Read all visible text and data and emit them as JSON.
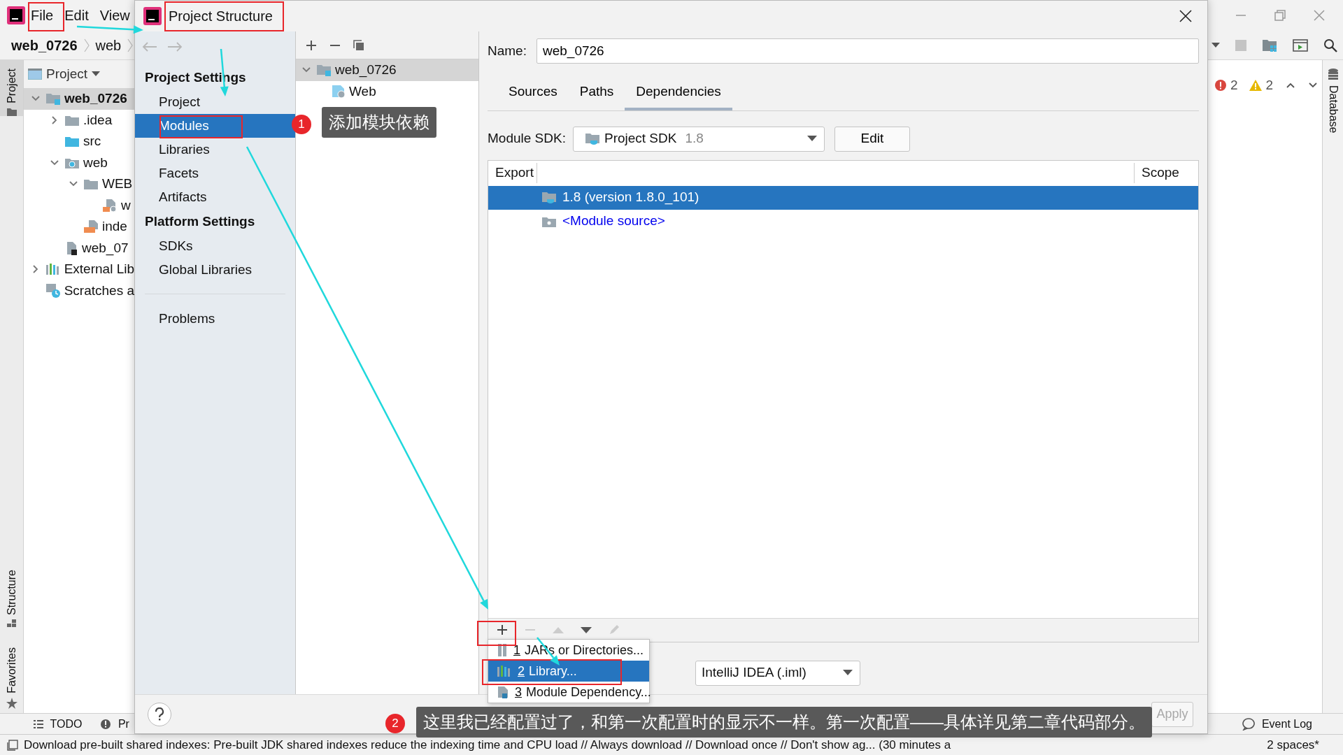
{
  "ide": {
    "menu": [
      "File",
      "Edit",
      "View"
    ],
    "breadcrumbs": [
      "web_0726",
      "web"
    ],
    "tool_strip": [
      "Project",
      "Structure",
      "Favorites"
    ],
    "project_panel": {
      "title": "Project",
      "tree": [
        {
          "label": "web_0726",
          "bold": true,
          "kind": "module",
          "expanded": true,
          "children": [
            {
              "label": ".idea",
              "kind": "folder",
              "expanded": false
            },
            {
              "label": "src",
              "kind": "source"
            },
            {
              "label": "web",
              "kind": "web",
              "expanded": true,
              "children": [
                {
                  "label": "WEB",
                  "kind": "folder",
                  "expanded": true,
                  "children": [
                    {
                      "label": "w",
                      "kind": "xml"
                    }
                  ]
                },
                {
                  "label": "inde",
                  "kind": "jsp"
                }
              ]
            },
            {
              "label": "web_07",
              "kind": "iml"
            }
          ]
        },
        {
          "label": "External Lib",
          "kind": "libs",
          "expanded": false
        },
        {
          "label": "Scratches a",
          "kind": "scratch"
        }
      ]
    },
    "inspections": {
      "errors": "2",
      "warnings": "2"
    },
    "right_strip": "Database",
    "bottom_tabs": [
      "TODO",
      "Pr"
    ],
    "event_log": "Event Log",
    "status": "Download pre-built shared indexes: Pre-built JDK shared indexes reduce the indexing time and CPU load // Always download // Download once // Don't show ag... (30 minutes a",
    "indent": "2 spaces*"
  },
  "dialog": {
    "title": "Project Structure",
    "nav": [
      {
        "kind": "header",
        "label": "Project Settings"
      },
      {
        "kind": "item",
        "label": "Project",
        "selected": false
      },
      {
        "kind": "item",
        "label": "Modules",
        "selected": true
      },
      {
        "kind": "item",
        "label": "Libraries",
        "selected": false
      },
      {
        "kind": "item",
        "label": "Facets",
        "selected": false
      },
      {
        "kind": "item",
        "label": "Artifacts",
        "selected": false
      },
      {
        "kind": "header",
        "label": "Platform Settings"
      },
      {
        "kind": "item",
        "label": "SDKs",
        "selected": false
      },
      {
        "kind": "item",
        "label": "Global Libraries",
        "selected": false
      },
      {
        "kind": "separator"
      },
      {
        "kind": "item",
        "label": "Problems",
        "selected": false
      }
    ],
    "modules": [
      {
        "label": "web_0726",
        "selected": true,
        "expanded": true,
        "children": [
          {
            "label": "Web",
            "selected": false
          }
        ]
      }
    ],
    "name_label": "Name:",
    "name_value": "web_0726",
    "tabs": [
      {
        "label": "Sources",
        "selected": false
      },
      {
        "label": "Paths",
        "selected": false
      },
      {
        "label": "Dependencies",
        "selected": true
      }
    ],
    "sdk_label": "Module SDK:",
    "sdk_value": "Project SDK",
    "sdk_version": "1.8",
    "edit_button": "Edit",
    "table": {
      "columns": [
        "Export",
        "Scope"
      ],
      "rows": [
        {
          "kind": "sdk",
          "text": "1.8 (version 1.8.0_101)",
          "selected": true
        },
        {
          "kind": "source",
          "text": "<Module source>",
          "selected": false
        }
      ]
    },
    "add_menu": [
      {
        "key": "1",
        "label": "JARs or Directories...",
        "kind": "jar",
        "selected": false
      },
      {
        "key": "2",
        "label": "Library...",
        "kind": "library",
        "selected": true
      },
      {
        "key": "3",
        "label": "Module Dependency...",
        "kind": "module",
        "selected": false
      }
    ],
    "format": "IntelliJ IDEA (.iml)",
    "apply": {
      "label": "Apply",
      "disabled": true
    },
    "callouts": [
      {
        "number": "1",
        "text": "添加模块依赖"
      },
      {
        "number": "2",
        "text": "这里我已经配置过了，和第一次配置时的显示不一样。第一次配置——具体详见第二章代码部分。"
      }
    ]
  }
}
